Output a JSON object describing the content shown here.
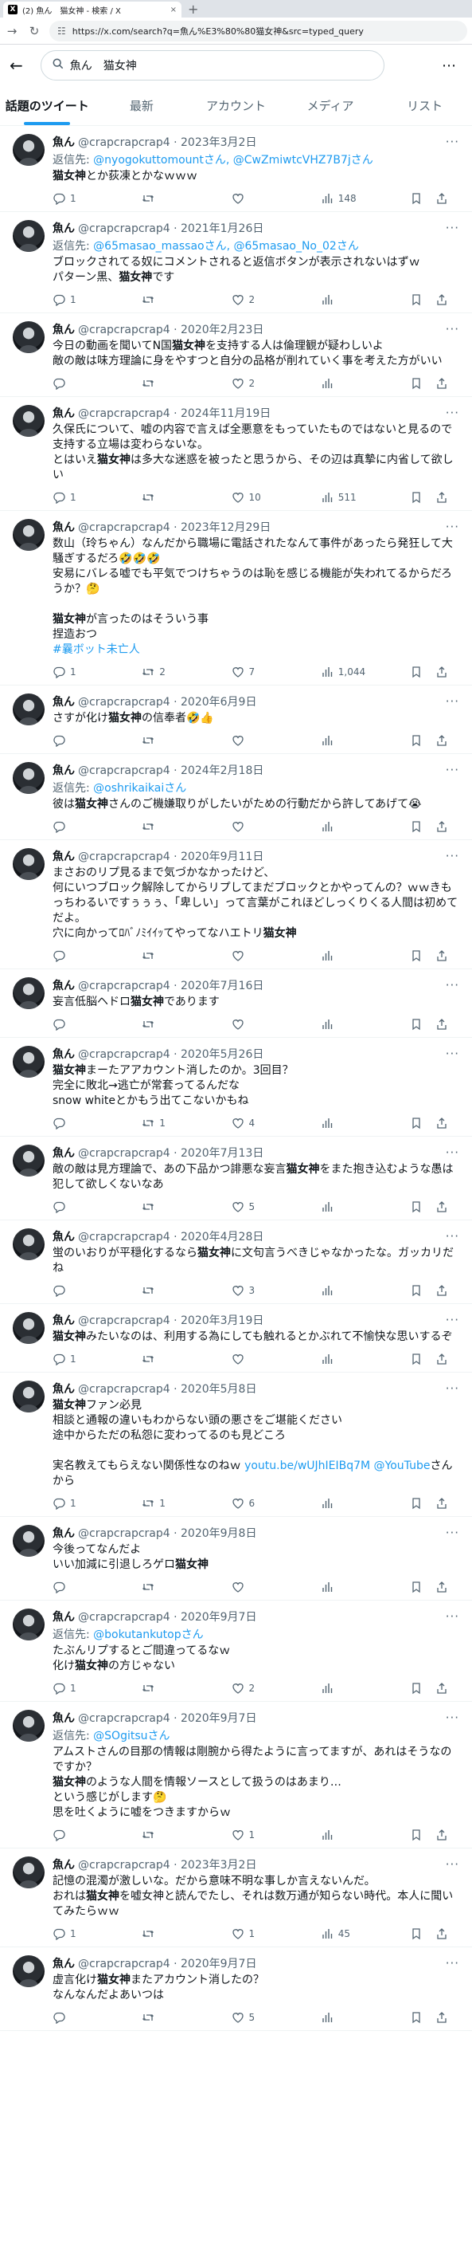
{
  "browser": {
    "tab_title": "(2) 魚ん　猫女神 - 検索 / X",
    "tab_close": "×",
    "new_tab": "+",
    "url": "https://x.com/search?q=魚ん%E3%80%80猫女神&src=typed_query"
  },
  "search": {
    "query": "魚ん　猫女神"
  },
  "tabs": [
    "話題のツイート",
    "最新",
    "アカウント",
    "メディア",
    "リスト"
  ],
  "tweets": [
    {
      "name": "魚ん",
      "meta": "@crapcrapcrap4 · 2023年3月2日",
      "reply_prefix": "返信先: ",
      "reply_to": "@nyogokuttomountさん, @CwZmiwtcVHZ7B7jさん",
      "segments": [
        {
          "b": true,
          "t": "猫女神"
        },
        {
          "t": "とか荻凍とかなｗｗｗ"
        }
      ],
      "replies": "1",
      "retweets": "",
      "likes": "",
      "views": "148"
    },
    {
      "name": "魚ん",
      "meta": "@crapcrapcrap4 · 2021年1月26日",
      "reply_prefix": "返信先: ",
      "reply_to": "@65masao_massaoさん, @65masao_No_02さん",
      "segments": [
        {
          "t": "ブロックされてる奴にコメントされると返信ボタンが表示されないはずｗ\nパターン黒、"
        },
        {
          "b": true,
          "t": "猫女神"
        },
        {
          "t": "です"
        }
      ],
      "replies": "1",
      "retweets": "",
      "likes": "2",
      "views": ""
    },
    {
      "name": "魚ん",
      "meta": "@crapcrapcrap4 · 2020年2月23日",
      "reply_prefix": "",
      "reply_to": "",
      "segments": [
        {
          "t": "今日の動画を聞いてN国"
        },
        {
          "b": true,
          "t": "猫女神"
        },
        {
          "t": "を支持する人は倫理観が疑わしいよ\n敵の敵は味方理論に身をやすつと自分の品格が削れていく事を考えた方がいい"
        }
      ],
      "replies": "",
      "retweets": "",
      "likes": "2",
      "views": ""
    },
    {
      "name": "魚ん",
      "meta": "@crapcrapcrap4 · 2024年11月19日",
      "reply_prefix": "",
      "reply_to": "",
      "segments": [
        {
          "t": "久保氏について、嘘の内容で言えば全悪意をもっていたものではないと見るので支持する立場は変わらないな。\nとはいえ"
        },
        {
          "b": true,
          "t": "猫女神"
        },
        {
          "t": "は多大な迷惑を被ったと思うから、その辺は真摯に内省して欲しい"
        }
      ],
      "replies": "1",
      "retweets": "",
      "likes": "10",
      "views": "511"
    },
    {
      "name": "魚ん",
      "meta": "@crapcrapcrap4 · 2023年12月29日",
      "reply_prefix": "",
      "reply_to": "",
      "segments": [
        {
          "t": "数山（玲ちゃん）なんだから職場に電話されたなんて事件があったら発狂して大騒ぎするだろ🤣🤣🤣\n安易にバレる嘘でも平気でつけちゃうのは恥を感じる機能が失われてるからだろうか？🤔\n\n"
        },
        {
          "b": true,
          "t": "猫女神"
        },
        {
          "t": "が言ったのはそういう事\n捏造おつ\n"
        },
        {
          "link": true,
          "t": "#曩ボット未亡人"
        }
      ],
      "replies": "1",
      "retweets": "2",
      "likes": "7",
      "views": "1,044"
    },
    {
      "name": "魚ん",
      "meta": "@crapcrapcrap4 · 2020年6月9日",
      "reply_prefix": "",
      "reply_to": "",
      "segments": [
        {
          "t": "さすが化け"
        },
        {
          "b": true,
          "t": "猫女神"
        },
        {
          "t": "の信奉者🤣👍"
        }
      ],
      "replies": "",
      "retweets": "",
      "likes": "",
      "views": ""
    },
    {
      "name": "魚ん",
      "meta": "@crapcrapcrap4 · 2024年2月18日",
      "reply_prefix": "返信先: ",
      "reply_to": "@oshrikaikaiさん",
      "segments": [
        {
          "t": "彼は"
        },
        {
          "b": true,
          "t": "猫女神"
        },
        {
          "t": "さんのご機嫌取りがしたいがための行動だから許してあげて😭"
        }
      ],
      "replies": "",
      "retweets": "",
      "likes": "",
      "views": ""
    },
    {
      "name": "魚ん",
      "meta": "@crapcrapcrap4 · 2020年9月11日",
      "reply_prefix": "",
      "reply_to": "",
      "segments": [
        {
          "t": "まさおのリプ見るまで気づかなかったけど、\n何にいつブロック解除してからリプしてまだブロックとかやってんの？ｗｗきもっちわるいですぅぅぅ、「卑しい」って言葉がこれほどしっくりくる人間は初めてだよ。\n穴に向かってﾛﾊﾞﾉﾐｲｲｯてやってなハエトリ"
        },
        {
          "b": true,
          "t": "猫女神"
        }
      ],
      "replies": "",
      "retweets": "",
      "likes": "",
      "views": ""
    },
    {
      "name": "魚ん",
      "meta": "@crapcrapcrap4 · 2020年7月16日",
      "reply_prefix": "",
      "reply_to": "",
      "segments": [
        {
          "t": "妄言低脳ヘドロ"
        },
        {
          "b": true,
          "t": "猫女神"
        },
        {
          "t": "であります"
        }
      ],
      "replies": "",
      "retweets": "",
      "likes": "",
      "views": ""
    },
    {
      "name": "魚ん",
      "meta": "@crapcrapcrap4 · 2020年5月26日",
      "reply_prefix": "",
      "reply_to": "",
      "segments": [
        {
          "b": true,
          "t": "猫女神"
        },
        {
          "t": "まーたアアカウント消したのか。3回目？\n完全に敗北→逃亡が常套ってるんだな\nsnow whiteとかもう出てこないかもね"
        }
      ],
      "replies": "",
      "retweets": "1",
      "likes": "4",
      "views": ""
    },
    {
      "name": "魚ん",
      "meta": "@crapcrapcrap4 · 2020年7月13日",
      "reply_prefix": "",
      "reply_to": "",
      "segments": [
        {
          "t": "敵の敵は見方理論で、あの下品かつ誹悪な妄言"
        },
        {
          "b": true,
          "t": "猫女神"
        },
        {
          "t": "をまた抱き込むような愚は犯して欲しくないなあ"
        }
      ],
      "replies": "",
      "retweets": "",
      "likes": "5",
      "views": ""
    },
    {
      "name": "魚ん",
      "meta": "@crapcrapcrap4 · 2020年4月28日",
      "reply_prefix": "",
      "reply_to": "",
      "segments": [
        {
          "t": "蛍のいおりが平穏化するなら"
        },
        {
          "b": true,
          "t": "猫女神"
        },
        {
          "t": "に文句言うべきじゃなかったな。ガッカリだね"
        }
      ],
      "replies": "",
      "retweets": "",
      "likes": "3",
      "views": ""
    },
    {
      "name": "魚ん",
      "meta": "@crapcrapcrap4 · 2020年3月19日",
      "reply_prefix": "",
      "reply_to": "",
      "segments": [
        {
          "b": true,
          "t": "猫女神"
        },
        {
          "t": "みたいなのは、利用する為にしても触れるとかぶれて不愉快な思いするぞ"
        }
      ],
      "replies": "1",
      "retweets": "",
      "likes": "",
      "views": ""
    },
    {
      "name": "魚ん",
      "meta": "@crapcrapcrap4 · 2020年5月8日",
      "reply_prefix": "",
      "reply_to": "",
      "segments": [
        {
          "b": true,
          "t": "猫女神"
        },
        {
          "t": "ファン必見\n相談と通報の違いもわからない頭の悪さをご堪能ください\n途中からただの私怨に変わってるのも見どころ\n\n実名教えてもらえない関係性なのねｗ "
        },
        {
          "link": true,
          "t": "youtu.be/wUJhIEIBq7M @YouTube"
        },
        {
          "t": "さんから"
        }
      ],
      "replies": "1",
      "retweets": "1",
      "likes": "6",
      "views": ""
    },
    {
      "name": "魚ん",
      "meta": "@crapcrapcrap4 · 2020年9月8日",
      "reply_prefix": "",
      "reply_to": "",
      "segments": [
        {
          "t": "今後ってなんだよ\nいい加減に引退しろゲロ"
        },
        {
          "b": true,
          "t": "猫女神"
        }
      ],
      "replies": "",
      "retweets": "",
      "likes": "",
      "views": ""
    },
    {
      "name": "魚ん",
      "meta": "@crapcrapcrap4 · 2020年9月7日",
      "reply_prefix": "返信先: ",
      "reply_to": "@bokutankutopさん",
      "segments": [
        {
          "t": "たぶんリプするとご間違ってるなｗ\n化け"
        },
        {
          "b": true,
          "t": "猫女神"
        },
        {
          "t": "の方じゃない"
        }
      ],
      "replies": "1",
      "retweets": "",
      "likes": "2",
      "views": ""
    },
    {
      "name": "魚ん",
      "meta": "@crapcrapcrap4 · 2020年9月7日",
      "reply_prefix": "返信先: ",
      "reply_to": "@SOgitsuさん",
      "segments": [
        {
          "t": "アムストさんの目那の情報は剛腕から得たように言ってますが、あれはそうなのですか？\n"
        },
        {
          "b": true,
          "t": "猫女神"
        },
        {
          "t": "のような人間を情報ソースとして扱うのはあまり…\nという感じがします🤔\n思を吐くように嘘をつきますからｗ"
        }
      ],
      "replies": "",
      "retweets": "",
      "likes": "1",
      "views": ""
    },
    {
      "name": "魚ん",
      "meta": "@crapcrapcrap4 · 2023年3月2日",
      "reply_prefix": "",
      "reply_to": "",
      "segments": [
        {
          "t": "記憶の混濁が激しいな。だから意味不明な事しか言えないんだ。\nおれは"
        },
        {
          "b": true,
          "t": "猫女神"
        },
        {
          "t": "を嘘女神と読んでたし、それは数万通が知らない時代。本人に聞いてみたらｗｗ"
        }
      ],
      "replies": "1",
      "retweets": "",
      "likes": "1",
      "views": "45"
    },
    {
      "name": "魚ん",
      "meta": "@crapcrapcrap4 · 2020年9月7日",
      "reply_prefix": "",
      "reply_to": "",
      "segments": [
        {
          "t": "虚言化け"
        },
        {
          "b": true,
          "t": "猫女神"
        },
        {
          "t": "またアカウント消したの？\nなんなんだよあいつは"
        }
      ],
      "replies": "",
      "retweets": "",
      "likes": "5",
      "views": ""
    }
  ]
}
